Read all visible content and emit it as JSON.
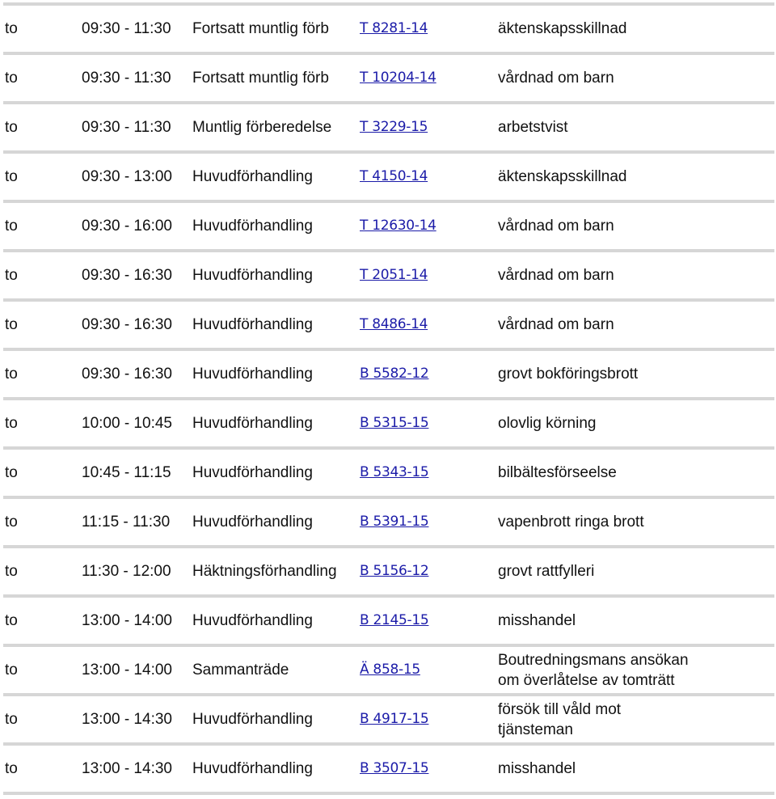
{
  "rows": [
    {
      "day": "to",
      "time": "09:30 - 11:30",
      "type": "Fortsatt muntlig förb",
      "case": "T 8281-14",
      "description": "äktenskapsskillnad"
    },
    {
      "day": "to",
      "time": "09:30 - 11:30",
      "type": "Fortsatt muntlig förb",
      "case": "T 10204-14",
      "description": "vårdnad om barn"
    },
    {
      "day": "to",
      "time": "09:30 - 11:30",
      "type": "Muntlig förberedelse",
      "case": "T 3229-15",
      "description": "arbetstvist"
    },
    {
      "day": "to",
      "time": "09:30 - 13:00",
      "type": "Huvudförhandling",
      "case": "T 4150-14",
      "description": "äktenskapsskillnad"
    },
    {
      "day": "to",
      "time": "09:30 - 16:00",
      "type": "Huvudförhandling",
      "case": "T 12630-14",
      "description": "vårdnad om barn"
    },
    {
      "day": "to",
      "time": "09:30 - 16:30",
      "type": "Huvudförhandling",
      "case": "T 2051-14",
      "description": "vårdnad om barn"
    },
    {
      "day": "to",
      "time": "09:30 - 16:30",
      "type": "Huvudförhandling",
      "case": "T 8486-14",
      "description": "vårdnad om barn"
    },
    {
      "day": "to",
      "time": "09:30 - 16:30",
      "type": "Huvudförhandling",
      "case": "B 5582-12",
      "description": "grovt bokföringsbrott"
    },
    {
      "day": "to",
      "time": "10:00 - 10:45",
      "type": "Huvudförhandling",
      "case": "B 5315-15",
      "description": "olovlig körning"
    },
    {
      "day": "to",
      "time": "10:45 - 11:15",
      "type": "Huvudförhandling",
      "case": "B 5343-15",
      "description": "bilbältesförseelse"
    },
    {
      "day": "to",
      "time": "11:15 - 11:30",
      "type": "Huvudförhandling",
      "case": "B 5391-15",
      "description": "vapenbrott ringa brott"
    },
    {
      "day": "to",
      "time": "11:30 - 12:00",
      "type": "Häktningsförhandling",
      "case": "B 5156-12",
      "description": "grovt rattfylleri"
    },
    {
      "day": "to",
      "time": "13:00 - 14:00",
      "type": "Huvudförhandling",
      "case": "B 2145-15",
      "description": "misshandel"
    },
    {
      "day": "to",
      "time": "13:00 - 14:00",
      "type": "Sammanträde",
      "case": "Ä 858-15",
      "description": "Boutredningsmans ansökan om överlåtelse av tomträtt"
    },
    {
      "day": "to",
      "time": "13:00 - 14:30",
      "type": "Huvudförhandling",
      "case": "B 4917-15",
      "description": "försök till våld mot tjänsteman"
    },
    {
      "day": "to",
      "time": "13:00 - 14:30",
      "type": "Huvudförhandling",
      "case": "B 3507-15",
      "description": "misshandel"
    }
  ],
  "colors": {
    "link": "#1b1ba8",
    "separator": "#d6d6d6"
  }
}
